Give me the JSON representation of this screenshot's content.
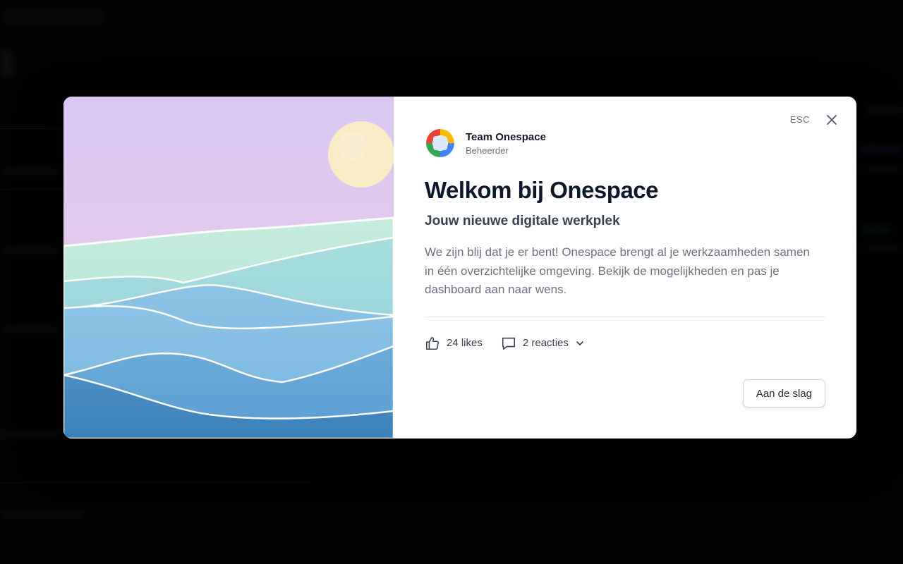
{
  "modal": {
    "esc_label": "ESC",
    "author": {
      "name": "Team Onespace",
      "role": "Beheerder"
    },
    "title": "Welkom bij Onespace",
    "subtitle": "Jouw nieuwe digitale werkplek",
    "body": "We zijn blij dat je er bent! Onespace brengt al je werkzaamheden samen in één overzichtelijke omgeving. Bekijk de mogelijkheden en pas je dashboard aan naar wens.",
    "likes_label": "24 likes",
    "comments_label": "2 reacties",
    "cta_label": "Aan de slag",
    "icons": {
      "close": "close-icon",
      "like": "thumbs-up-icon",
      "comment": "comment-icon",
      "expand": "chevron-down-icon"
    }
  },
  "colors": {
    "overlay": "#000000",
    "avatar_ring": [
      "#ea4335",
      "#fbbc05",
      "#34a853",
      "#4285f4"
    ],
    "sky_top": "#d9c8f3",
    "sky_bottom": "#f0cce0",
    "sun": "#fbecc6",
    "water_light": "#b6e6dd",
    "water_mid": "#8fc4e4",
    "water_deep": "#4d93c4"
  }
}
